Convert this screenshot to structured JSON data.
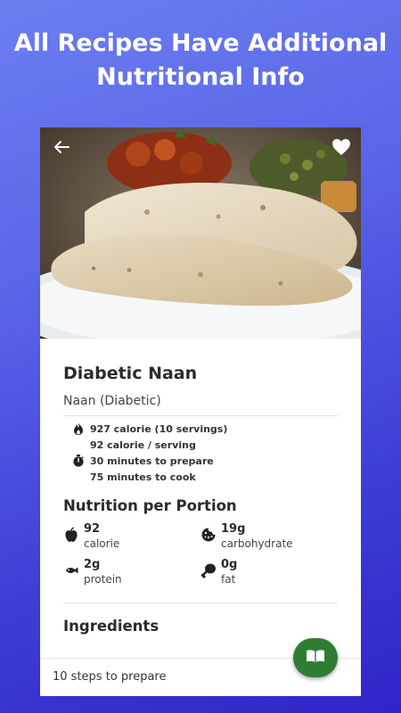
{
  "banner": {
    "line1": "All Recipes Have Additional",
    "line2": "Nutritional Info"
  },
  "recipe": {
    "title": "Diabetic Naan",
    "subtitle": "Naan (Diabetic)",
    "stats": {
      "total_calories": "927 calorie (10 servings)",
      "per_serving": "92 calorie / serving",
      "prep_time": "30 minutes to prepare",
      "cook_time": "75 minutes to cook"
    }
  },
  "nutrition": {
    "heading": "Nutrition per Portion",
    "items": [
      {
        "value": "92",
        "label": "calorie",
        "icon": "apple-icon"
      },
      {
        "value": "19g",
        "label": "carbohydrate",
        "icon": "cookie-icon"
      },
      {
        "value": "2g",
        "label": "protein",
        "icon": "fish-icon"
      },
      {
        "value": "0g",
        "label": "fat",
        "icon": "drumstick-icon"
      }
    ]
  },
  "ingredients": {
    "heading": "Ingredients"
  },
  "bottom_bar": {
    "steps_text": "10 steps to prepare"
  },
  "colors": {
    "fab": "#2e7d32",
    "background_top": "#6b7ff0",
    "background_bottom": "#3024c8"
  }
}
